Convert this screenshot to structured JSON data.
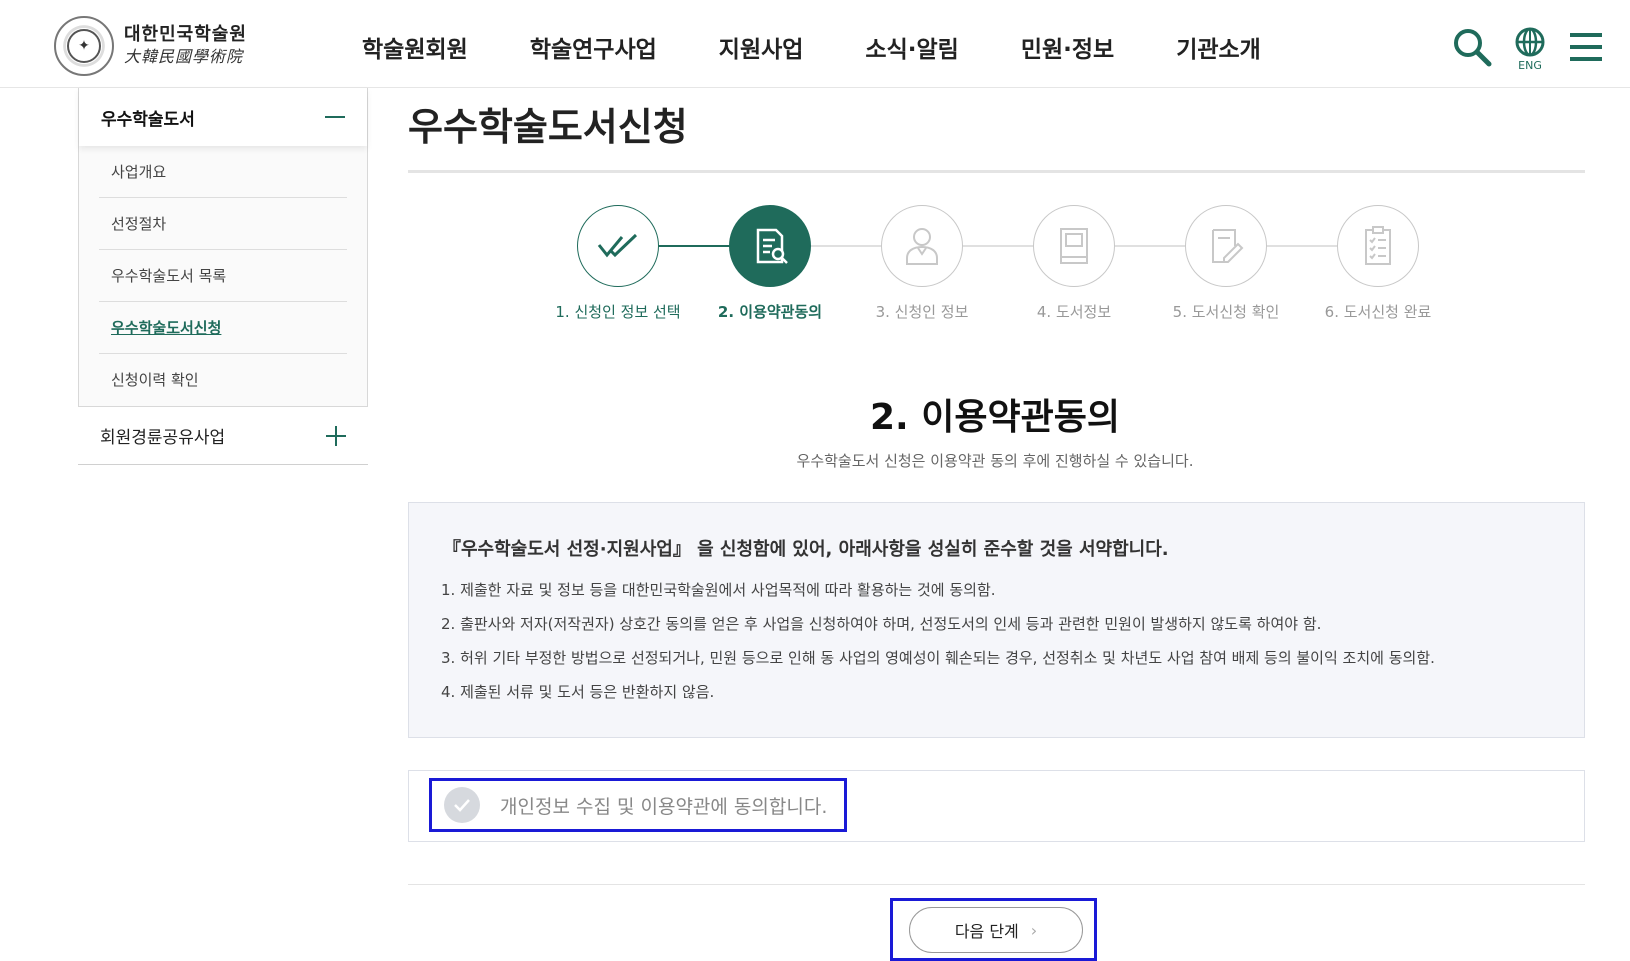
{
  "header": {
    "logo_kr": "대한민국학술원",
    "logo_hanja": "大韓民國學術院",
    "nav": [
      "학술원회원",
      "학술연구사업",
      "지원사업",
      "소식·알림",
      "민원·정보",
      "기관소개"
    ],
    "eng_label": "ENG"
  },
  "sidebar": {
    "open_group": {
      "label": "우수학술도서",
      "items": [
        {
          "label": "사업개요",
          "active": false
        },
        {
          "label": "선정절차",
          "active": false
        },
        {
          "label": "우수학술도서 목록",
          "active": false
        },
        {
          "label": "우수학술도서신청",
          "active": true
        },
        {
          "label": "신청이력 확인",
          "active": false
        }
      ]
    },
    "closed_group": {
      "label": "회원경륜공유사업"
    }
  },
  "main": {
    "page_title": "우수학술도서신청",
    "steps": [
      {
        "label": "1. 신청인 정보 선택",
        "state": "done",
        "icon": "double-check-icon"
      },
      {
        "label": "2. 이용약관동의",
        "state": "current",
        "icon": "document-search-icon"
      },
      {
        "label": "3. 신청인 정보",
        "state": "todo",
        "icon": "person-icon"
      },
      {
        "label": "4. 도서정보",
        "state": "todo",
        "icon": "book-icon"
      },
      {
        "label": "5. 도서신청 확인",
        "state": "todo",
        "icon": "document-edit-icon"
      },
      {
        "label": "6. 도서신청 완료",
        "state": "todo",
        "icon": "clipboard-check-icon"
      }
    ],
    "section_title": "2. 이용약관동의",
    "section_desc": "우수학술도서 신청은 이용약관 동의 후에 진행하실 수 있습니다.",
    "terms": {
      "heading": "『우수학술도서 선정·지원사업』 을 신청함에 있어, 아래사항을 성실히 준수할 것을 서약합니다.",
      "items": [
        "1. 제출한 자료 및 정보 등을 대한민국학술원에서 사업목적에 따라 활용하는 것에 동의함.",
        "2. 출판사와 저자(저작권자) 상호간 동의를 얻은 후 사업을 신청하여야 하며, 선정도서의 인세 등과 관련한 민원이 발생하지 않도록 하여야 함.",
        "3. 허위 기타 부정한 방법으로 선정되거나, 민원 등으로 인해 동 사업의 영예성이 훼손되는 경우, 선정취소 및 차년도 사업 참여 배제 등의 불이익 조치에 동의함.",
        "4. 제출된 서류 및 도서 등은 반환하지 않음."
      ]
    },
    "agree_label": "개인정보 수집 및 이용약관에 동의합니다.",
    "next_button": "다음 단계",
    "colors": {
      "accent": "#1f6b5b",
      "highlight": "#1a1ad6"
    }
  }
}
